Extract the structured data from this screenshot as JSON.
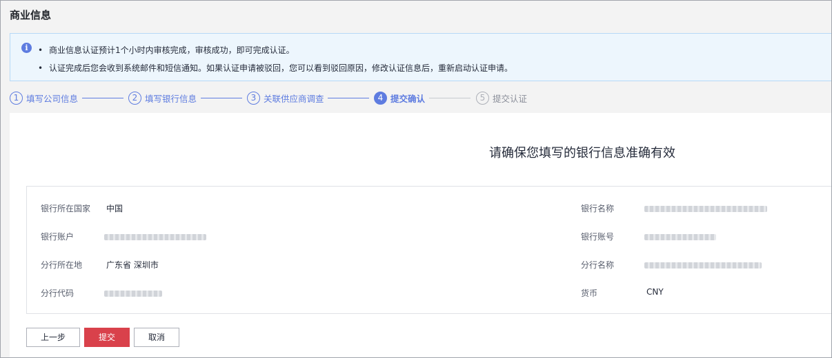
{
  "page_title": "商业信息",
  "notice": {
    "icon": "info-icon",
    "lines": [
      "商业信息认证预计1个小时内审核完成，审核成功，即可完成认证。",
      "认证完成后您会收到系统邮件和短信通知。如果认证申请被驳回，您可以看到驳回原因，修改认证信息后，重新启动认证申请。"
    ]
  },
  "steps": [
    {
      "num": "1",
      "label": "填写公司信息",
      "state": "done"
    },
    {
      "num": "2",
      "label": "填写银行信息",
      "state": "done"
    },
    {
      "num": "3",
      "label": "关联供应商调查",
      "state": "done"
    },
    {
      "num": "4",
      "label": "提交确认",
      "state": "active"
    },
    {
      "num": "5",
      "label": "提交认证",
      "state": "todo"
    }
  ],
  "confirm_title": "请确保您填写的银行信息准确有效",
  "fields": {
    "bank_country": {
      "label": "银行所在国家",
      "value": "中国"
    },
    "bank_account_name": {
      "label": "银行账户",
      "value": ""
    },
    "branch_location": {
      "label": "分行所在地",
      "value": "广东省  深圳市"
    },
    "branch_code": {
      "label": "分行代码",
      "value": ""
    },
    "bank_name": {
      "label": "银行名称",
      "value": ""
    },
    "account_number": {
      "label": "银行账号",
      "value": ""
    },
    "branch_name": {
      "label": "分行名称",
      "value": ""
    },
    "currency": {
      "label": "货币",
      "value": "CNY"
    }
  },
  "buttons": {
    "prev": "上一步",
    "submit": "提交",
    "cancel": "取消"
  },
  "colors": {
    "accent": "#5e7ce0",
    "primary_button": "#d9414b",
    "notice_bg": "#edf6fd"
  }
}
